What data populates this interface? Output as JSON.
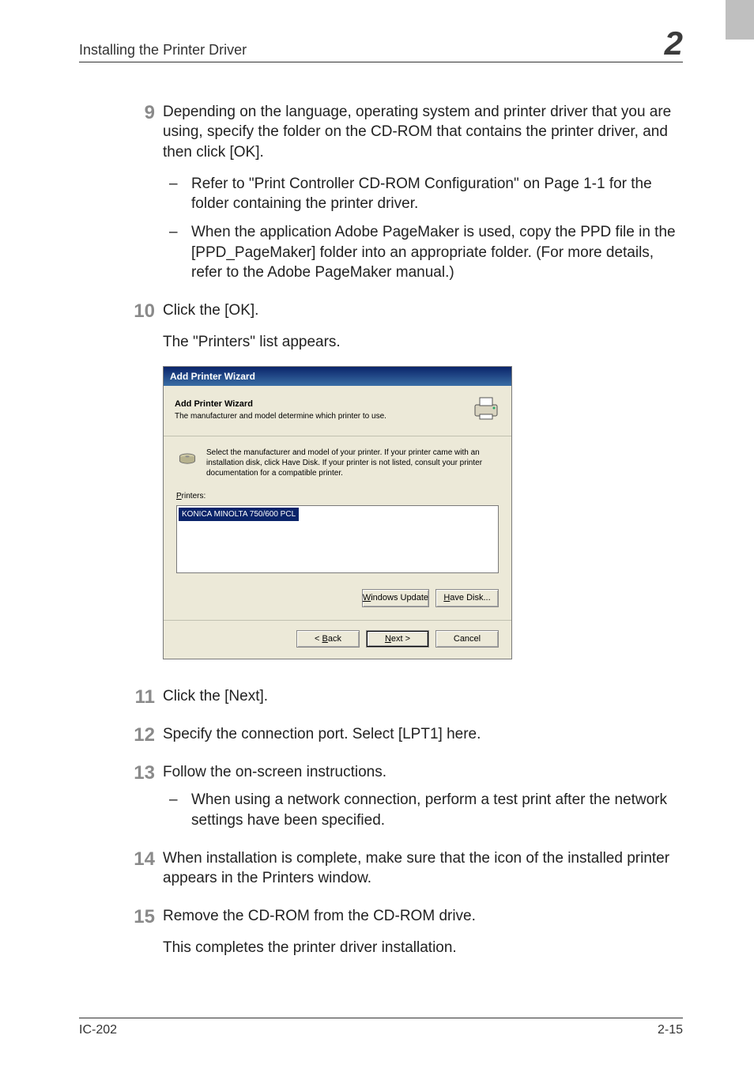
{
  "header": {
    "section_title": "Installing the Printer Driver",
    "chapter_number": "2"
  },
  "steps": {
    "s9": {
      "num": "9",
      "p1": "Depending on the language, operating system and printer driver that you are using, specify the folder on the CD-ROM that contains the printer driver, and then click [OK].",
      "b1": "Refer to \"Print Controller CD-ROM Configuration\" on Page 1-1 for the folder containing the printer driver.",
      "b2": "When the application Adobe PageMaker is used, copy the PPD file in the [PPD_PageMaker] folder into an appropriate folder. (For more details, refer to the Adobe PageMaker manual.)"
    },
    "s10": {
      "num": "10",
      "p1": "Click the [OK].",
      "p2": "The \"Printers\" list appears."
    },
    "s11": {
      "num": "11",
      "p1": "Click the [Next]."
    },
    "s12": {
      "num": "12",
      "p1": "Specify the connection port. Select [LPT1] here."
    },
    "s13": {
      "num": "13",
      "p1": "Follow the on-screen instructions.",
      "b1": "When using a network connection, perform a test print after the network settings have been specified."
    },
    "s14": {
      "num": "14",
      "p1": "When installation is complete, make sure that the icon of the installed printer appears in the Printers window."
    },
    "s15": {
      "num": "15",
      "p1": "Remove the CD-ROM from the CD-ROM drive.",
      "p2": "This completes the printer driver installation."
    }
  },
  "dialog": {
    "titlebar": "Add Printer Wizard",
    "header_bold": "Add Printer Wizard",
    "header_sub": "The manufacturer and model determine which printer to use.",
    "info_text": "Select the manufacturer and model of your printer. If your printer came with an installation disk, click Have Disk. If your printer is not listed, consult your printer documentation for a compatible printer.",
    "printers_label": "Printers:",
    "selected_printer": "KONICA MINOLTA 750/600 PCL",
    "buttons": {
      "windows_update_pre": "W",
      "windows_update_rest": "indows Update",
      "have_disk_pre": "H",
      "have_disk_rest": "ave Disk...",
      "back_pre": "< ",
      "back_u": "B",
      "back_rest": "ack",
      "next_pre": "",
      "next_u": "N",
      "next_rest": "ext >",
      "cancel": "Cancel"
    }
  },
  "footer": {
    "left": "IC-202",
    "right": "2-15"
  }
}
